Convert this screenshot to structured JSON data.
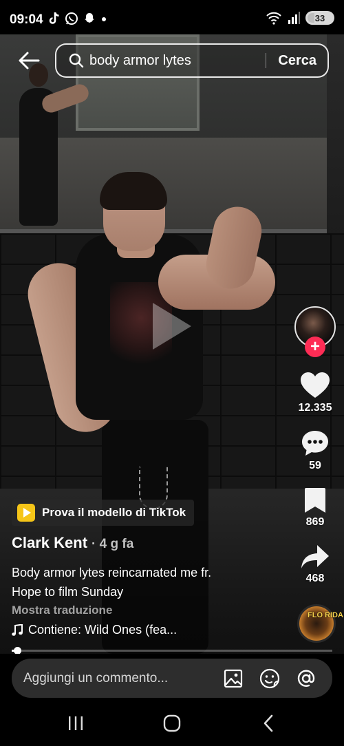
{
  "status_bar": {
    "time": "09:04",
    "notification_icons": [
      "tiktok-icon",
      "whatsapp-icon",
      "snapchat-icon",
      "dot-icon"
    ],
    "battery": "33"
  },
  "search": {
    "query": "body armor lytes",
    "submit_label": "Cerca"
  },
  "video": {
    "state": "paused"
  },
  "rail": {
    "likes": "12.335",
    "comments": "59",
    "saves": "869",
    "shares": "468",
    "follow_symbol": "+",
    "music_disc_text": "FLO RIDA"
  },
  "effect": {
    "label": "Prova il modello di TikTok"
  },
  "post": {
    "author": "Clark Kent",
    "posted": "· 4 g fa",
    "caption_line1": "Body armor lytes reincarnated me fr.",
    "caption_line2": "Hope to film Sunday",
    "translate_label": "Mostra traduzione",
    "sound": "Contiene: Wild Ones (fea..."
  },
  "progress": {
    "fraction": 0.018
  },
  "comment": {
    "placeholder": "Aggiungi un commento..."
  },
  "colors": {
    "follow": "#fe2c55",
    "effect_icon": "#f5c518"
  }
}
